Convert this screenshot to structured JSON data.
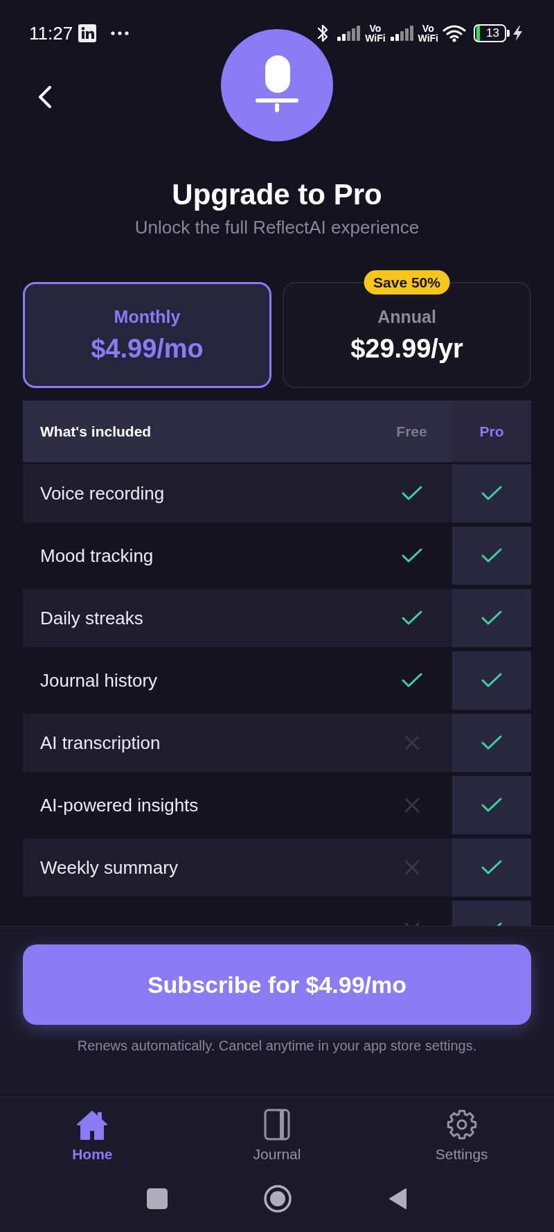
{
  "status_bar": {
    "time": "11:27",
    "network_labels": [
      "Vo WiFi",
      "Vo WiFi"
    ],
    "battery": "13"
  },
  "header": {
    "title": "Upgrade to Pro",
    "subtitle": "Unlock the full ReflectAI experience"
  },
  "plans": [
    {
      "name": "Monthly",
      "price": "$4.99/mo",
      "selected": true
    },
    {
      "name": "Annual",
      "price": "$29.99/yr",
      "badge": "Save 50%",
      "selected": false
    }
  ],
  "comparison": {
    "columns": [
      "What's included",
      "Free",
      "Pro"
    ],
    "rows": [
      {
        "feature": "Voice recording",
        "free": true,
        "pro": true
      },
      {
        "feature": "Mood tracking",
        "free": true,
        "pro": true
      },
      {
        "feature": "Daily streaks",
        "free": true,
        "pro": true
      },
      {
        "feature": "Journal history",
        "free": true,
        "pro": true
      },
      {
        "feature": "AI transcription",
        "free": false,
        "pro": true
      },
      {
        "feature": "AI-powered insights",
        "free": false,
        "pro": true
      },
      {
        "feature": "Weekly summary",
        "free": false,
        "pro": true
      },
      {
        "free": false,
        "pro": true
      }
    ]
  },
  "subscribe_button": "Subscribe for $4.99/mo",
  "footnote": "Renews automatically. Cancel anytime in your app store settings.",
  "nav": [
    {
      "label": "Home",
      "selected": true
    },
    {
      "label": "Journal",
      "selected": false
    },
    {
      "label": "Settings",
      "selected": false
    }
  ]
}
